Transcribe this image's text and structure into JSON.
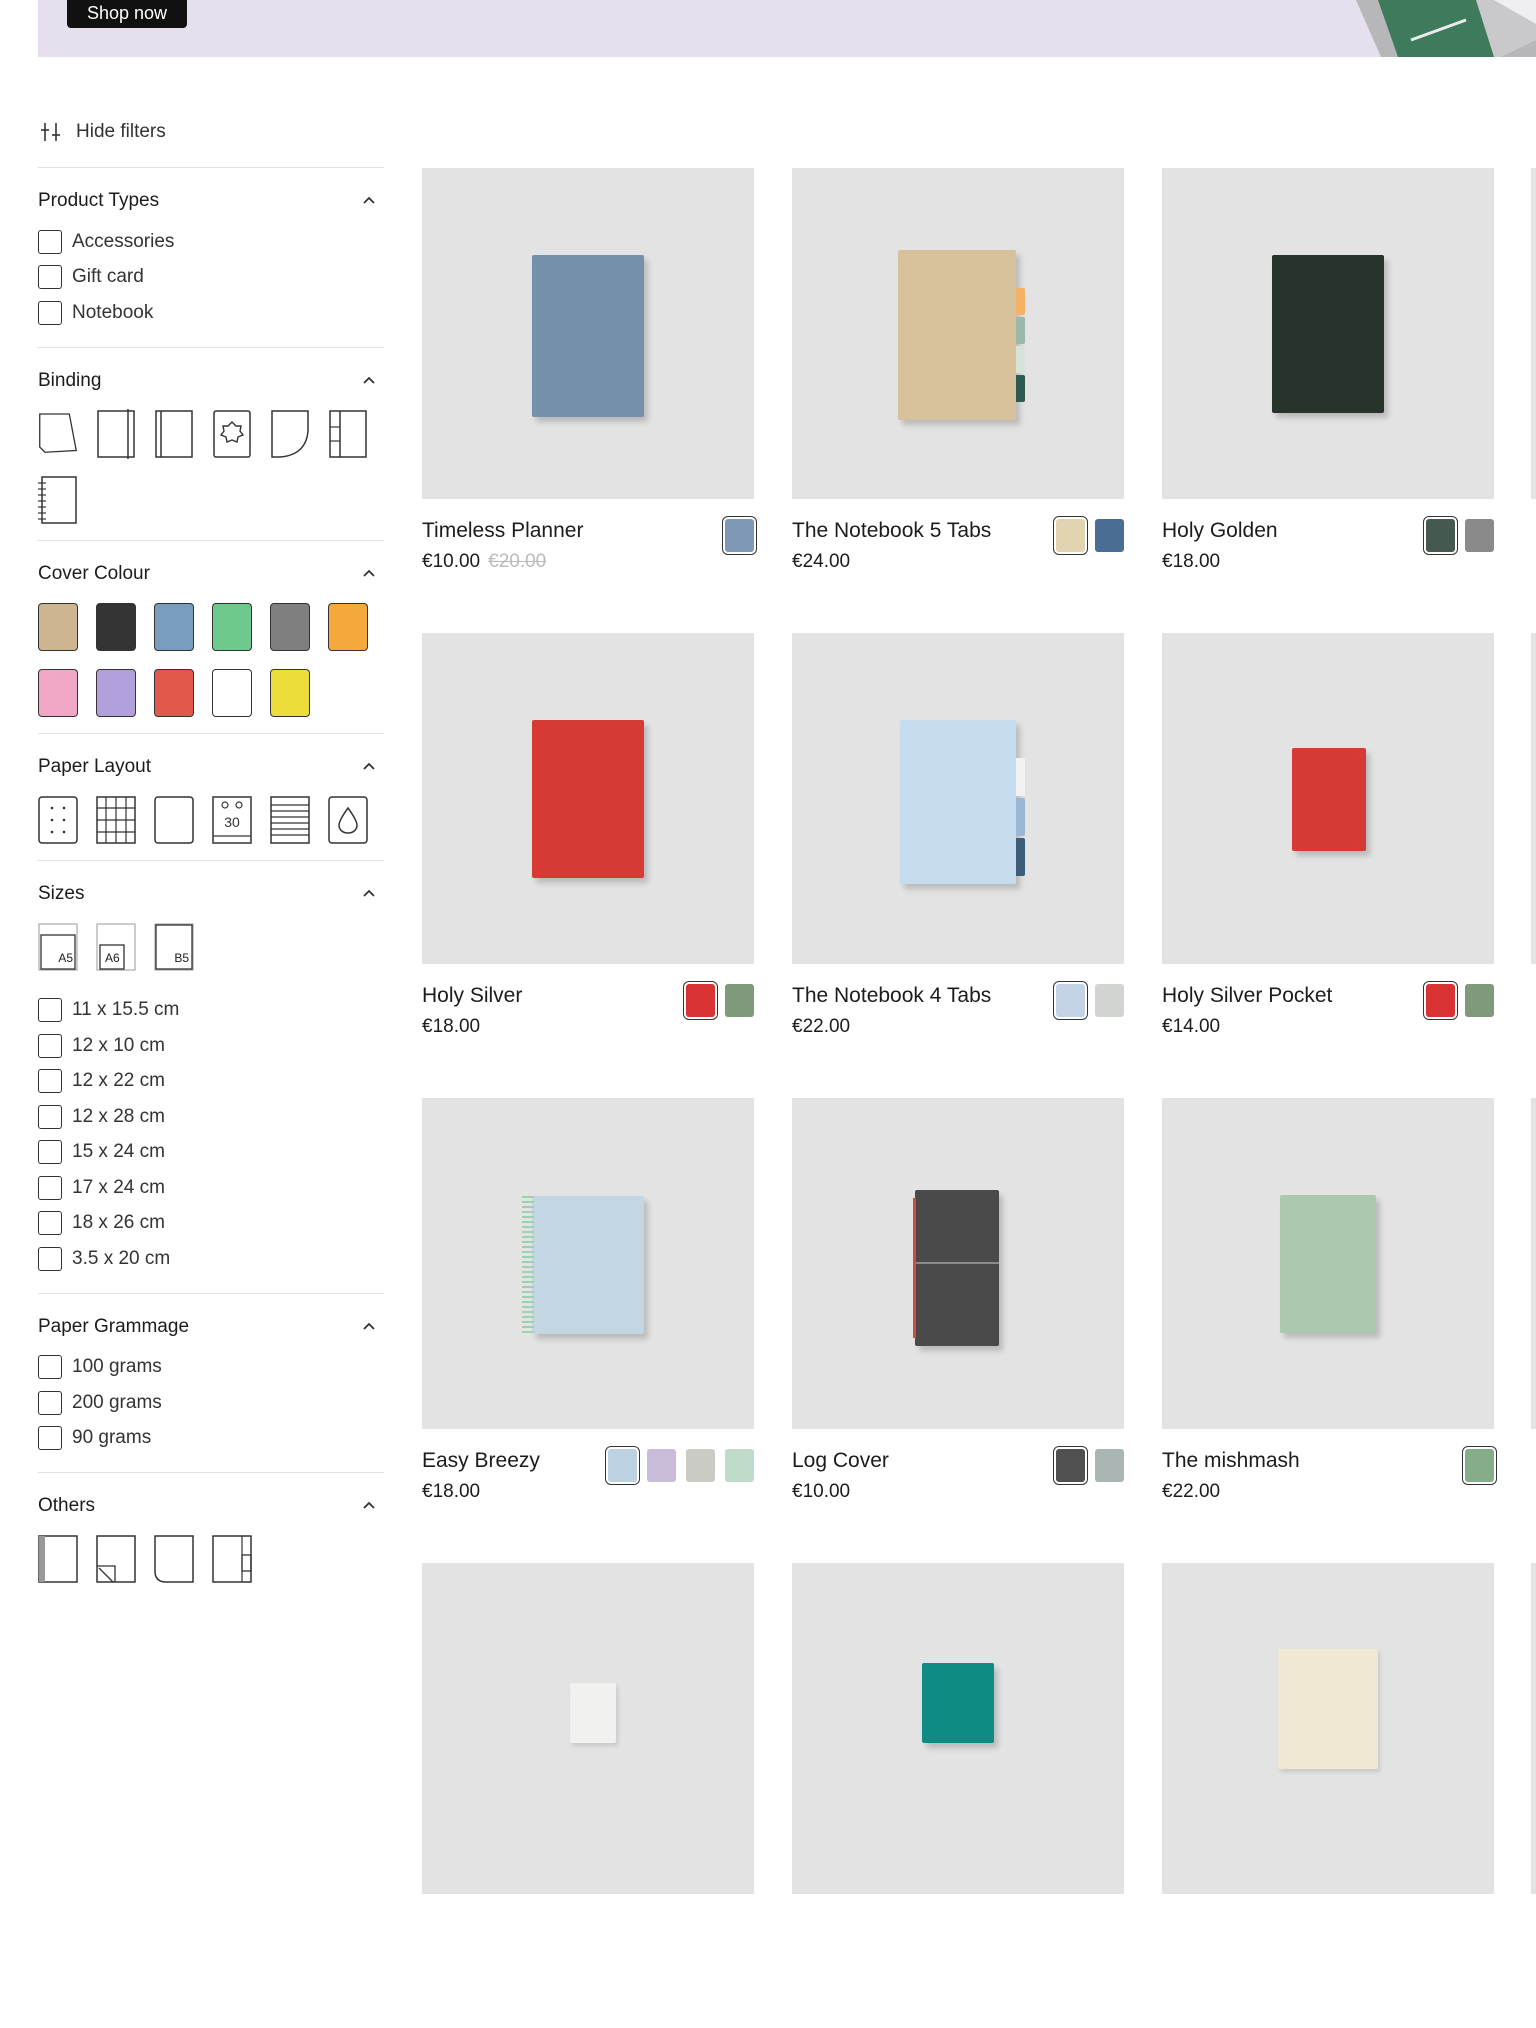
{
  "hero": {
    "shop_button": "Shop now"
  },
  "filters_toggle": {
    "label": "Hide filters",
    "icon": "sliders-icon"
  },
  "sidebar": {
    "product_types": {
      "title": "Product Types",
      "options": [
        "Accessories",
        "Gift card",
        "Notebook"
      ]
    },
    "binding": {
      "title": "Binding"
    },
    "cover_colour": {
      "title": "Cover Colour",
      "colors": [
        "#cdb592",
        "#343434",
        "#7a9cbf",
        "#6ec98c",
        "#7f7f7f",
        "#f6a93b",
        "#f2a7c6",
        "#b2a0dc",
        "#e2594b",
        "#ffffff",
        "#eddd3a"
      ]
    },
    "paper_layout": {
      "title": "Paper Layout",
      "planner_number": "30"
    },
    "sizes": {
      "title": "Sizes",
      "size_icons": [
        "A5",
        "A6",
        "B5"
      ],
      "options": [
        "11 x 15.5 cm",
        "12 x 10 cm",
        "12 x 22 cm",
        "12 x 28 cm",
        "15 x 24 cm",
        "17 x 24 cm",
        "18 x 26 cm",
        "3.5 x 20 cm"
      ]
    },
    "paper_grammage": {
      "title": "Paper Grammage",
      "options": [
        "100 grams",
        "200 grams",
        "90 grams"
      ]
    },
    "others": {
      "title": "Others"
    }
  },
  "products": [
    {
      "name": "Timeless Planner",
      "price": "€10.00",
      "old_price": "€20.00",
      "cover": "#7590ab",
      "swatches": [
        "#7f98b5"
      ]
    },
    {
      "name": "The Notebook 5 Tabs",
      "price": "€24.00",
      "old_price": "",
      "cover": "#d6c19a",
      "swatches": [
        "#e2d3b1",
        "#4a6d93"
      ]
    },
    {
      "name": "Holy Golden",
      "price": "€18.00",
      "old_price": "",
      "cover": "#27332b",
      "swatches": [
        "#465951",
        "#8a8a8a"
      ]
    },
    {
      "name": "Holy Silver",
      "price": "€18.00",
      "old_price": "",
      "cover": "#d63a35",
      "swatches": [
        "#d83232",
        "#7f9a7a"
      ]
    },
    {
      "name": "The Notebook 4 Tabs",
      "price": "€22.00",
      "old_price": "",
      "cover": "#c5dcef",
      "swatches": [
        "#c4d3e6",
        "#d2d4d1"
      ]
    },
    {
      "name": "Holy Silver Pocket",
      "price": "€14.00",
      "old_price": "",
      "cover": "#d63a35",
      "swatches": [
        "#d83232",
        "#7f9a7a"
      ]
    },
    {
      "name": "Easy Breezy",
      "price": "€18.00",
      "old_price": "",
      "cover": "#c2d6e3",
      "swatches": [
        "#bcd1e2",
        "#c9bcda",
        "#cbcbc5",
        "#bfdcca"
      ]
    },
    {
      "name": "Log Cover",
      "price": "€10.00",
      "old_price": "",
      "cover": "#4a4a4a",
      "swatches": [
        "#505050",
        "#aab6b3"
      ]
    },
    {
      "name": "The mishmash",
      "price": "€22.00",
      "old_price": "",
      "cover": "#aac9ae",
      "swatches": [
        "#86ad8a"
      ]
    },
    {
      "name": "",
      "price": "",
      "old_price": "",
      "cover": "#f1f1f0",
      "swatches": []
    },
    {
      "name": "",
      "price": "",
      "old_price": "",
      "cover": "#0e8c84",
      "swatches": []
    },
    {
      "name": "",
      "price": "",
      "old_price": "",
      "cover": "#efe8d2",
      "swatches": []
    }
  ]
}
